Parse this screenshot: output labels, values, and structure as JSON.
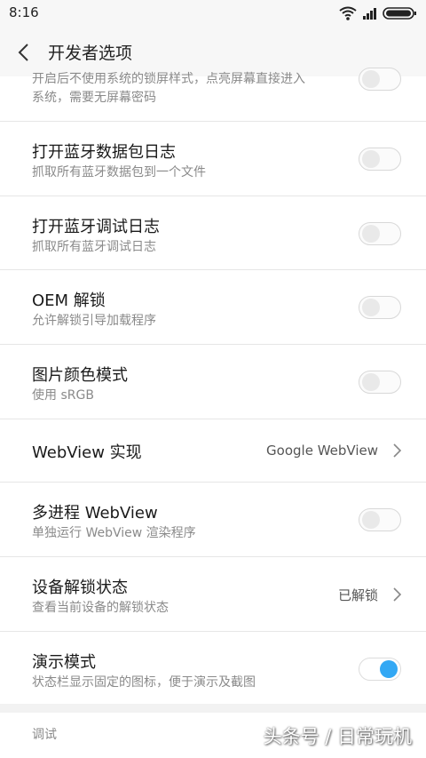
{
  "status_bar": {
    "time": "8:16",
    "icons": [
      "wifi-icon",
      "signal-icon",
      "battery-icon"
    ]
  },
  "app_bar": {
    "title": "开发者选项"
  },
  "rows": {
    "0": {
      "title": "",
      "subtitle_line1": "开启后不使用系统的锁屏样式，点亮屏幕直接进入",
      "subtitle_line2": "系统，需要无屏幕密码",
      "toggle_on": false
    },
    "1": {
      "title": "打开蓝牙数据包日志",
      "subtitle": "抓取所有蓝牙数据包到一个文件",
      "toggle_on": false
    },
    "2": {
      "title": "打开蓝牙调试日志",
      "subtitle": "抓取所有蓝牙调试日志",
      "toggle_on": false
    },
    "3": {
      "title": "OEM 解锁",
      "subtitle": "允许解锁引导加载程序",
      "toggle_on": false
    },
    "4": {
      "title": "图片颜色模式",
      "subtitle": "使用 sRGB",
      "toggle_on": false
    },
    "5": {
      "title": "WebView 实现",
      "value": "Google WebView"
    },
    "6": {
      "title": "多进程 WebView",
      "subtitle": "单独运行 WebView 渲染程序",
      "toggle_on": false
    },
    "7": {
      "title": "设备解锁状态",
      "subtitle": "查看当前设备的解锁状态",
      "value": "已解锁"
    },
    "8": {
      "title": "演示模式",
      "subtitle": "状态栏显示固定的图标，便于演示及截图",
      "toggle_on": true
    }
  },
  "section": {
    "label": "调试"
  },
  "watermark": "头条号 / 日常玩机",
  "colors": {
    "accent": "#33a8f4",
    "background": "#f7f7f7",
    "row_background": "#ffffff",
    "divider": "#e6e6e6",
    "secondary_text": "#8a8a8a"
  }
}
